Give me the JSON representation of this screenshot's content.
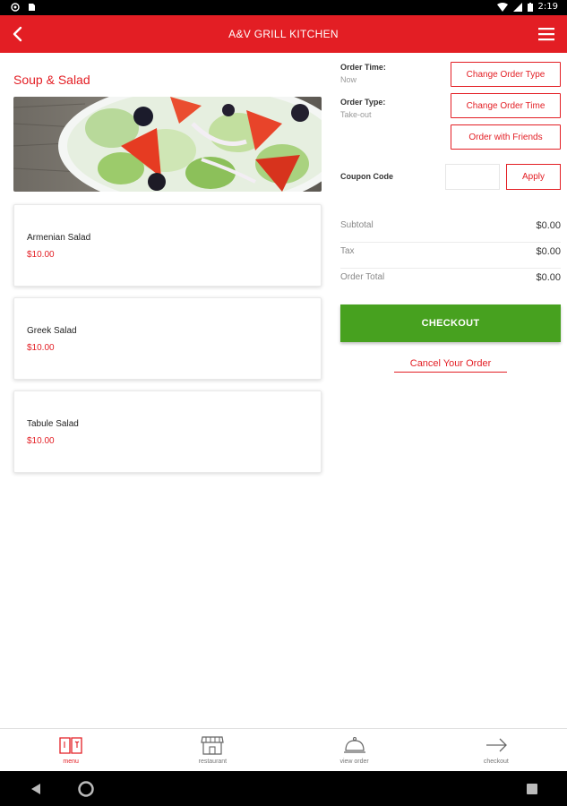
{
  "status_bar": {
    "time": "2:19"
  },
  "app_bar": {
    "title": "A&V GRILL KITCHEN"
  },
  "category": {
    "title": "Soup & Salad"
  },
  "menu_items": [
    {
      "name": "Armenian Salad",
      "price": "$10.00"
    },
    {
      "name": "Greek Salad",
      "price": "$10.00"
    },
    {
      "name": "Tabule Salad",
      "price": "$10.00"
    }
  ],
  "order": {
    "time_label": "Order Time:",
    "time_value": "Now",
    "type_label": "Order Type:",
    "type_value": "Take-out",
    "change_type_label": "Change Order Type",
    "change_time_label": "Change Order Time",
    "order_friends_label": "Order with Friends"
  },
  "coupon": {
    "label": "Coupon Code",
    "value": "",
    "placeholder": "",
    "apply_label": "Apply"
  },
  "summary": {
    "subtotal_label": "Subtotal",
    "subtotal_value": "$0.00",
    "tax_label": "Tax",
    "tax_value": "$0.00",
    "total_label": "Order Total",
    "total_value": "$0.00"
  },
  "actions": {
    "checkout_label": "CHECKOUT",
    "cancel_label": "Cancel Your Order"
  },
  "bottom_nav": [
    {
      "label": "menu",
      "icon": "menu-book-icon"
    },
    {
      "label": "restaurant",
      "icon": "storefront-icon"
    },
    {
      "label": "view order",
      "icon": "cloche-icon"
    },
    {
      "label": "checkout",
      "icon": "arrow-right-icon"
    }
  ],
  "colors": {
    "brand": "#e31e24",
    "checkout": "#47a11f"
  }
}
